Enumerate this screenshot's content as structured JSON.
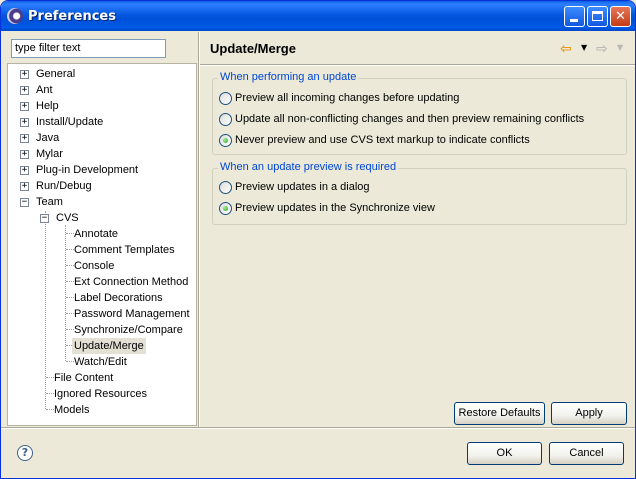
{
  "window": {
    "title": "Preferences",
    "minimize_glyph": "",
    "maximize_glyph": "",
    "close_glyph": "✕"
  },
  "filter": {
    "value": "type filter text"
  },
  "tree": {
    "items": [
      {
        "label": "General",
        "expander": "+"
      },
      {
        "label": "Ant",
        "expander": "+"
      },
      {
        "label": "Help",
        "expander": "+"
      },
      {
        "label": "Install/Update",
        "expander": "+"
      },
      {
        "label": "Java",
        "expander": "+"
      },
      {
        "label": "Mylar",
        "expander": "+"
      },
      {
        "label": "Plug-in Development",
        "expander": "+"
      },
      {
        "label": "Run/Debug",
        "expander": "+"
      },
      {
        "label": "Team",
        "expander": "−"
      },
      {
        "label": "CVS",
        "expander": "−"
      },
      {
        "label": "Annotate"
      },
      {
        "label": "Comment Templates"
      },
      {
        "label": "Console"
      },
      {
        "label": "Ext Connection Method"
      },
      {
        "label": "Label Decorations"
      },
      {
        "label": "Password Management"
      },
      {
        "label": "Synchronize/Compare"
      },
      {
        "label": "Update/Merge",
        "selected": true
      },
      {
        "label": "Watch/Edit"
      },
      {
        "label": "File Content"
      },
      {
        "label": "Ignored Resources"
      },
      {
        "label": "Models"
      }
    ]
  },
  "page": {
    "title": "Update/Merge",
    "back_icon": "⇦",
    "forward_icon": "⇨",
    "dropdown_glyph": "▼"
  },
  "groups": {
    "performing": {
      "legend": "When performing an update",
      "options": [
        {
          "label": "Preview all incoming changes before updating",
          "checked": false
        },
        {
          "label": "Update all non-conflicting changes and then preview remaining conflicts",
          "checked": false
        },
        {
          "label": "Never preview and use CVS text markup to indicate conflicts",
          "checked": true
        }
      ]
    },
    "preview": {
      "legend": "When an update preview is required",
      "options": [
        {
          "label": "Preview updates in a dialog",
          "checked": false
        },
        {
          "label": "Preview updates in the Synchronize view",
          "checked": true
        }
      ]
    }
  },
  "buttons": {
    "restore_defaults": "Restore Defaults",
    "apply": "Apply",
    "ok": "OK",
    "cancel": "Cancel"
  },
  "help": {
    "glyph": "?"
  }
}
